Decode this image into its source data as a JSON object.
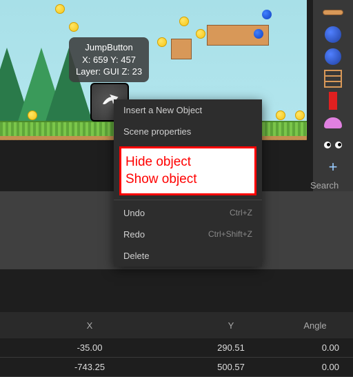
{
  "tooltip": {
    "name": "JumpButton",
    "coords": "X: 659  Y: 457",
    "layer": "Layer: GUI  Z: 23"
  },
  "context_menu": {
    "insert": "Insert a New Object",
    "scene_props": "Scene properties",
    "hide": "Hide object",
    "show": "Show object",
    "undo": "Undo",
    "undo_shortcut": "Ctrl+Z",
    "redo": "Redo",
    "redo_shortcut": "Ctrl+Shift+Z",
    "delete": "Delete"
  },
  "search": {
    "placeholder": "Search"
  },
  "props": {
    "headers": {
      "x": "X",
      "y": "Y",
      "angle": "Angle"
    },
    "rows": [
      {
        "x": "-35.00",
        "y": "290.51",
        "angle": "0.00"
      },
      {
        "x": "-743.25",
        "y": "500.57",
        "angle": "0.00"
      }
    ]
  }
}
